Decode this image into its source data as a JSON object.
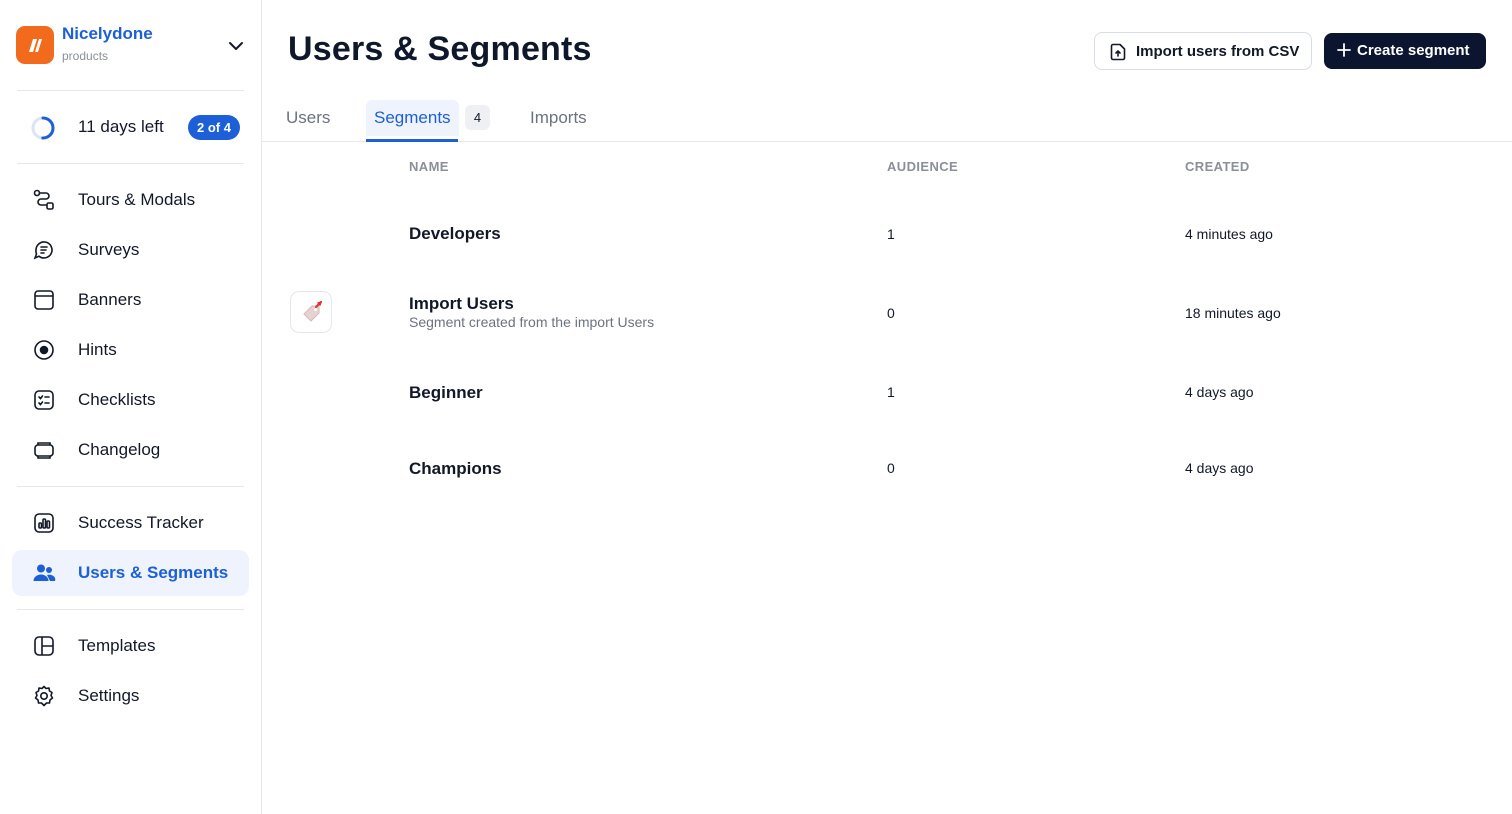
{
  "brand": {
    "name": "Nicelydone",
    "subtitle": "products"
  },
  "trial": {
    "text": "11 days left",
    "badge": "2 of 4",
    "progress": 0.5
  },
  "sidebar": {
    "items": [
      {
        "label": "Tours & Modals",
        "icon": "tours-icon"
      },
      {
        "label": "Surveys",
        "icon": "surveys-icon"
      },
      {
        "label": "Banners",
        "icon": "banners-icon"
      },
      {
        "label": "Hints",
        "icon": "hints-icon"
      },
      {
        "label": "Checklists",
        "icon": "checklists-icon"
      },
      {
        "label": "Changelog",
        "icon": "changelog-icon"
      },
      {
        "label": "Success Tracker",
        "icon": "success-tracker-icon"
      },
      {
        "label": "Users & Segments",
        "icon": "users-icon",
        "active": true
      },
      {
        "label": "Templates",
        "icon": "templates-icon"
      },
      {
        "label": "Settings",
        "icon": "settings-icon"
      }
    ]
  },
  "header": {
    "title": "Users & Segments",
    "import_label": "Import users from CSV",
    "create_label": "Create segment"
  },
  "tabs": [
    {
      "label": "Users"
    },
    {
      "label": "Segments",
      "count": "4",
      "active": true
    },
    {
      "label": "Imports"
    }
  ],
  "table": {
    "columns": [
      "NAME",
      "AUDIENCE",
      "CREATED"
    ],
    "rows": [
      {
        "name": "Developers",
        "description": "",
        "audience": "1",
        "created": "4 minutes ago"
      },
      {
        "name": "Import Users",
        "description": "Segment created from the import Users",
        "audience": "0",
        "created": "18 minutes ago"
      },
      {
        "name": "Beginner",
        "description": "",
        "audience": "1",
        "created": "4 days ago"
      },
      {
        "name": "Champions",
        "description": "",
        "audience": "0",
        "created": "4 days ago"
      }
    ]
  },
  "colors": {
    "accent": "#1d5fd6",
    "brand": "#f26a1b",
    "primary_button": "#0b1530"
  }
}
